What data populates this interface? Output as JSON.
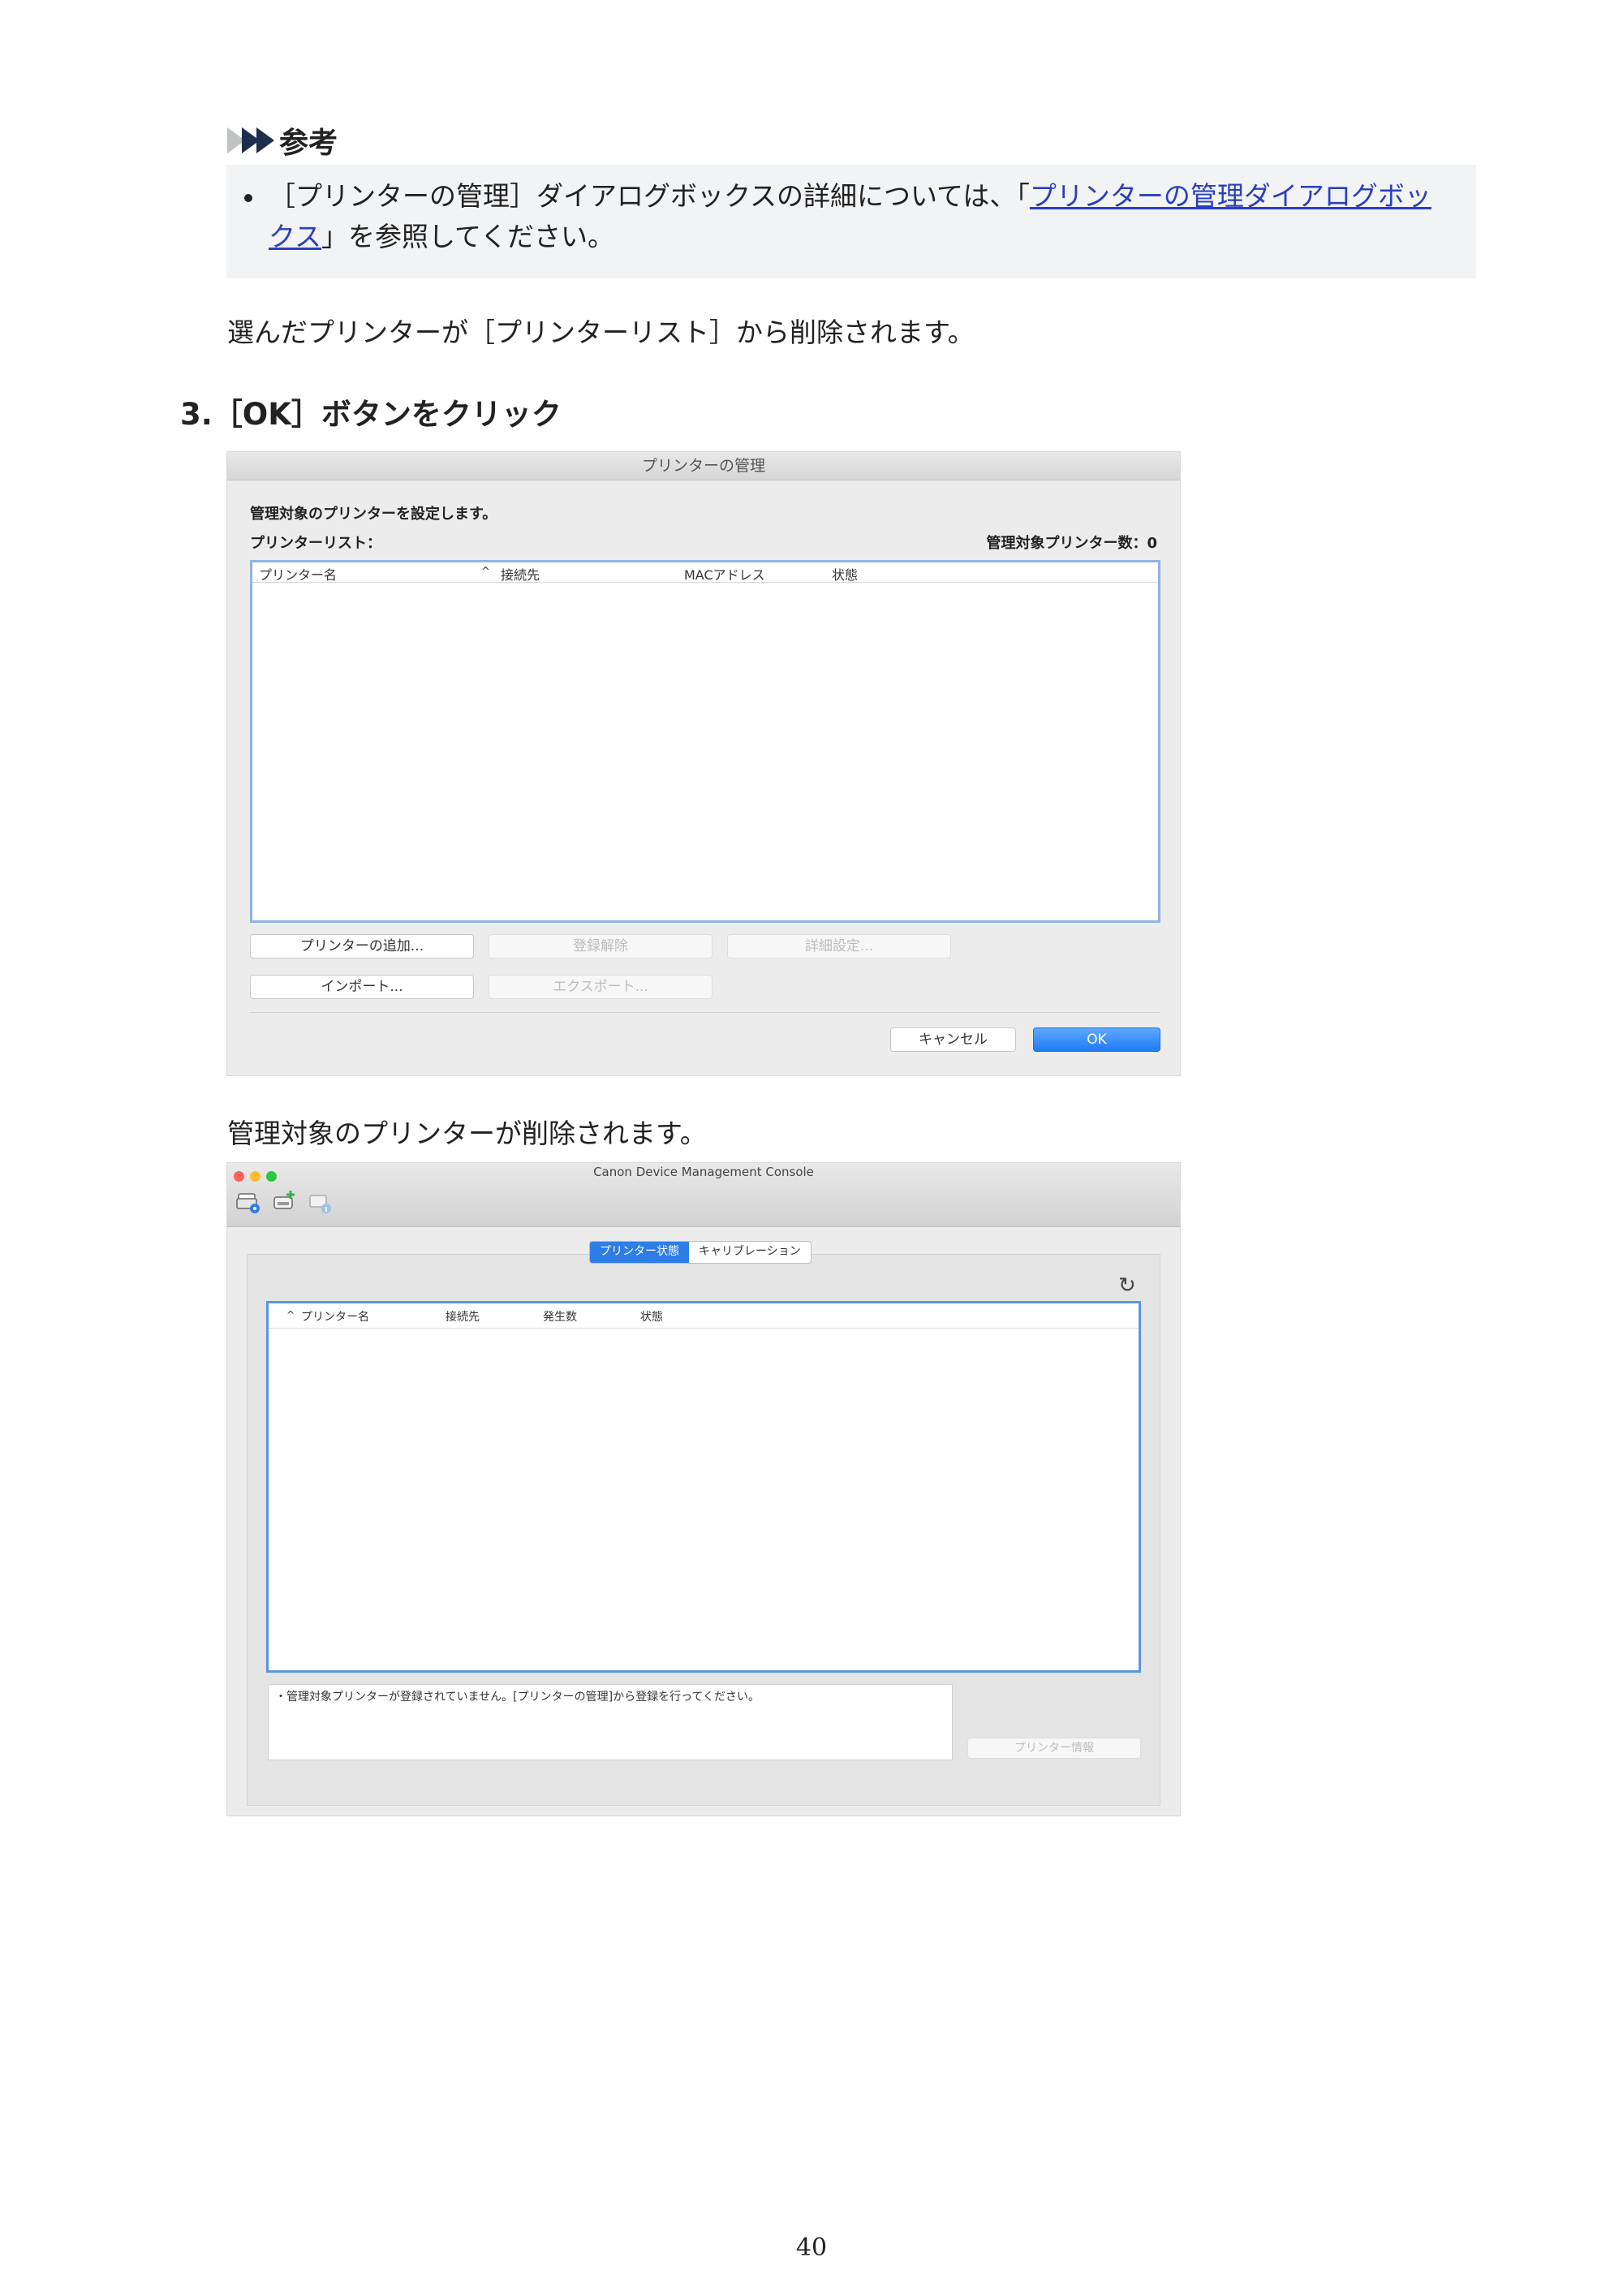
{
  "note": {
    "title": "参考",
    "text_before": "［プリンターの管理］ダイアログボックスの詳細については、「",
    "link_text": "プリンターの管理ダイアログボックス",
    "text_after": "」を参照してください。"
  },
  "para_removed": "選んだプリンターが［プリンターリスト］から削除されます。",
  "step3": "3.［OK］ボタンをクリック",
  "dialog": {
    "title": "プリンターの管理",
    "heading": "管理対象のプリンターを設定します。",
    "list_label": "プリンターリスト：",
    "count_label": "管理対象プリンター数：0",
    "columns": [
      "プリンター名",
      "接続先",
      "MACアドレス",
      "状態"
    ],
    "sort_indicator": "^",
    "buttons": {
      "add": "プリンターの追加...",
      "unregister": "登録解除",
      "details": "詳細設定...",
      "import": "インポート...",
      "export": "エクスポート...",
      "cancel": "キャンセル",
      "ok": "OK"
    }
  },
  "para_deleted": "管理対象のプリンターが削除されます。",
  "console": {
    "window_title": "Canon Device Management Console",
    "tabs": [
      "プリンター状態",
      "キャリブレーション"
    ],
    "columns": [
      "プリンター名",
      "接続先",
      "発生数",
      "状態"
    ],
    "sort_indicator": "^",
    "refresh_glyph": "↻",
    "message": "・管理対象プリンターが登録されていません。[プリンターの管理]から登録を行ってください。",
    "printer_info_button": "プリンター情報"
  },
  "page_number": "40",
  "colors": {
    "link": "#2a3fbf",
    "ok_button": "#1e7cf2",
    "selected_tab": "#2f7de6",
    "close_light": "#fe5f57",
    "minimize_light": "#febc2e",
    "zoom_light": "#28c840"
  }
}
